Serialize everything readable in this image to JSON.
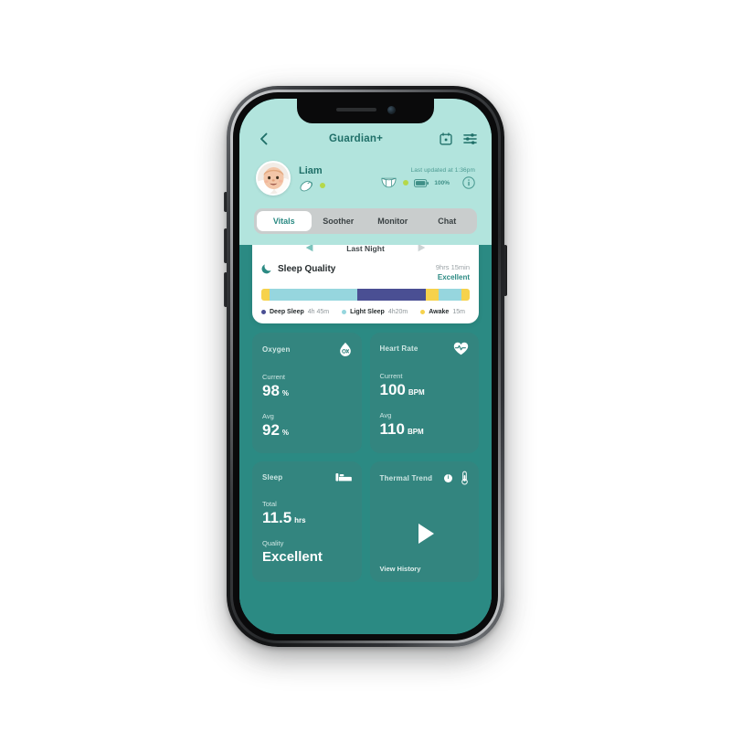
{
  "header": {
    "title": "Guardian+",
    "back_icon": "chevron-left-icon",
    "calendar_icon": "calendar-icon",
    "settings_icon": "sliders-icon"
  },
  "profile": {
    "name": "Liam",
    "soother_icon": "pacifier-icon",
    "status_dot": "online-dot",
    "last_updated": "Last updated at 1:36pm",
    "diaper_icon": "diaper-icon",
    "diaper_dot": "status-dot",
    "battery_icon": "battery-icon",
    "battery_level": "100%",
    "info_icon": "info-circle-icon"
  },
  "tabs": [
    {
      "label": "Vitals",
      "active": true
    },
    {
      "label": "Soother",
      "active": false
    },
    {
      "label": "Monitor",
      "active": false
    },
    {
      "label": "Chat",
      "active": false
    }
  ],
  "sleep_card": {
    "prev_icon": "triangle-left-icon",
    "night_label": "Last Night",
    "next_icon": "triangle-right-icon",
    "moon_icon": "moon-icon",
    "title": "Sleep Quality",
    "duration": "9hrs 15min",
    "quality": "Excellent",
    "legend": [
      {
        "name": "Deep Sleep",
        "value": "4h 45m",
        "color": "#4a4f93"
      },
      {
        "name": "Light Sleep",
        "value": "4h20m",
        "color": "#96d6de"
      },
      {
        "name": "Awake",
        "value": "15m",
        "color": "#f6d24c"
      }
    ],
    "segments": [
      {
        "type": "awake",
        "pct": 4
      },
      {
        "type": "light",
        "pct": 42
      },
      {
        "type": "deep",
        "pct": 33
      },
      {
        "type": "awake",
        "pct": 6
      },
      {
        "type": "light",
        "pct": 11
      },
      {
        "type": "awake",
        "pct": 4
      }
    ]
  },
  "metrics": {
    "oxygen": {
      "title": "Oxygen",
      "icon": "oxygen-drop-icon",
      "current_label": "Current",
      "current_value": "98",
      "current_unit": "%",
      "avg_label": "Avg",
      "avg_value": "92",
      "avg_unit": "%"
    },
    "heart_rate": {
      "title": "Heart Rate",
      "icon": "heart-pulse-icon",
      "current_label": "Current",
      "current_value": "100",
      "current_unit": "BPM",
      "avg_label": "Avg",
      "avg_value": "110",
      "avg_unit": "BPM"
    },
    "sleep": {
      "title": "Sleep",
      "icon": "bed-icon",
      "total_label": "Total",
      "total_value": "11.5",
      "total_unit": "hrs",
      "quality_label": "Quality",
      "quality_value": "Excellent"
    },
    "thermal": {
      "title": "Thermal Trend",
      "info_icon": "info-badge-icon",
      "thermometer_icon": "thermometer-icon",
      "play_icon": "play-icon",
      "view_history": "View History"
    }
  },
  "colors": {
    "app_top_bg": "#b2e4dd",
    "app_body_bg": "#2b8a83",
    "card_bg": "#33857f",
    "accent_teal": "#2b8a83",
    "deep_sleep": "#4a4f93",
    "light_sleep": "#96d6de",
    "awake": "#f6d24c",
    "status_green": "#b5d84a"
  }
}
